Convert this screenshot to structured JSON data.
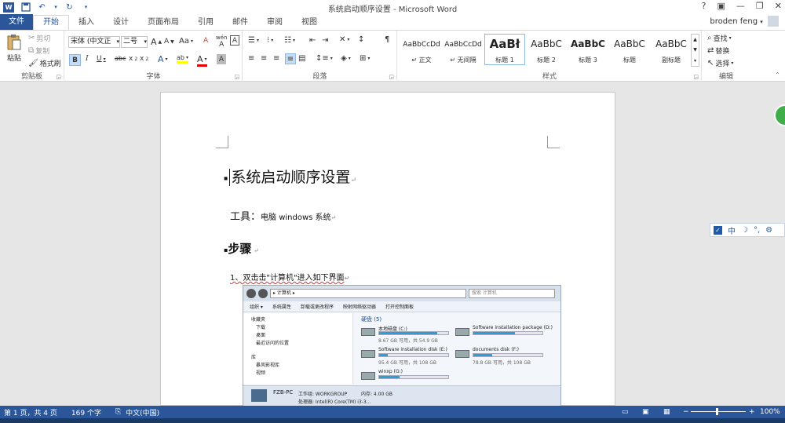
{
  "titlebar": {
    "title": "系统启动顺序设置 - Microsoft Word",
    "help": "?",
    "minimize": "—",
    "restore": "❐",
    "close": "✕"
  },
  "tabs": [
    "文件",
    "开始",
    "插入",
    "设计",
    "页面布局",
    "引用",
    "邮件",
    "审阅",
    "视图"
  ],
  "user": "broden feng",
  "clipboard": {
    "label": "剪贴板",
    "paste": "粘贴",
    "cut": "剪切",
    "copy": "复制",
    "format_painter": "格式刷"
  },
  "font": {
    "label": "字体",
    "font_name": "宋体 (中文正",
    "font_size": "二号",
    "grow": "A",
    "shrink": "A",
    "change_case": "Aa",
    "bold": "B",
    "italic": "I",
    "underline": "U",
    "strike": "abc",
    "sub": "x",
    "sup": "x",
    "effects": "A",
    "highlight": "ab",
    "color": "A",
    "shading": "A",
    "phonetic": "wén",
    "clear": "A",
    "char_border": "A"
  },
  "paragraph": {
    "label": "段落"
  },
  "styles": {
    "label": "样式",
    "items": [
      {
        "sample": "AaBbCcDd",
        "name": "↵ 正文"
      },
      {
        "sample": "AaBbCcDd",
        "name": "↵ 无间隔"
      },
      {
        "sample": "AaBł",
        "name": "标题 1"
      },
      {
        "sample": "AaBbC",
        "name": "标题 2"
      },
      {
        "sample": "AaBbC",
        "name": "标题 3"
      },
      {
        "sample": "AaBbC",
        "name": "标题"
      },
      {
        "sample": "AaBbC",
        "name": "副标题"
      }
    ]
  },
  "editing": {
    "label": "编辑",
    "find": "查找",
    "replace": "替换",
    "select": "选择"
  },
  "document": {
    "heading": "系统启动顺序设置",
    "tools_label": "工具：",
    "tools_value": "电脑   windows 系统",
    "steps": "步骤",
    "step1": "1、双击击\"计算机\"进入如下界面"
  },
  "explorer": {
    "address": "▸ 计算机 ▸",
    "search": "搜索 计算机",
    "toolbar": [
      "组织 ▾",
      "系统属性",
      "卸载或更改程序",
      "映射网络驱动器",
      "打开控制面板"
    ],
    "nav": [
      "收藏夹",
      "下载",
      "桌面",
      "最近访问的位置",
      "库",
      "暴风影视库",
      "视频"
    ],
    "section": "硬盘 (5)",
    "drives": [
      {
        "name": "本地磁盘 (C:)",
        "info": "8.67 GB 可用，共 54.9 GB",
        "fill": 0.84
      },
      {
        "name": "Software installation package (D:)",
        "info": "",
        "fill": 0.6
      },
      {
        "name": "Software installation disk (E:)",
        "info": "95.4 GB 可用，共 108 GB",
        "fill": 0.12
      },
      {
        "name": "documents disk (F:)",
        "info": "78.8 GB 可用，共 108 GB",
        "fill": 0.27
      },
      {
        "name": "winxp (G:)",
        "info": "",
        "fill": 0.3
      }
    ],
    "pc_name": "FZB-PC",
    "workgroup": "工作组: WORKGROUP",
    "memory": "内存: 4.00 GB",
    "cpu": "处理器: Intel(R) Core(TM) i3-3..."
  },
  "ime": [
    "中",
    "☽",
    "°,",
    "⚙"
  ],
  "status": {
    "page": "第 1 页，共 4 页",
    "words": "169 个字",
    "lang": "中文(中国)",
    "zoom": "100%"
  },
  "colors": {
    "accent": "#2b579a",
    "drive_bar": "#26a0da"
  }
}
